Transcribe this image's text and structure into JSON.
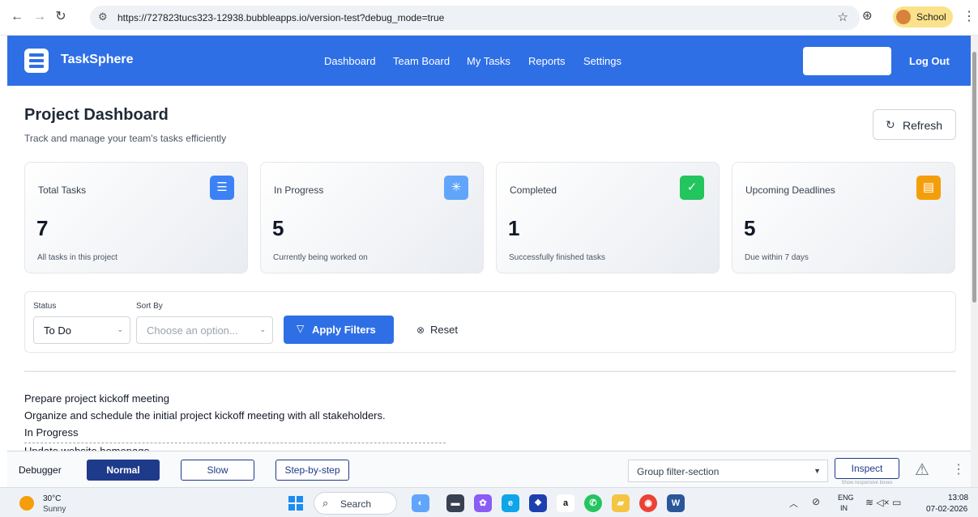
{
  "browser": {
    "url": "https://727823tucs323-12938.bubbleapps.io/version-test?debug_mode=true",
    "profile_label": "School"
  },
  "header": {
    "brand": "TaskSphere",
    "nav": [
      "Dashboard",
      "Team Board",
      "My Tasks",
      "Reports",
      "Settings"
    ],
    "logout": "Log Out"
  },
  "page": {
    "title": "Project Dashboard",
    "subtitle": "Track and manage your team's tasks efficiently",
    "refresh_label": "Refresh"
  },
  "cards": [
    {
      "title": "Total Tasks",
      "value": "7",
      "desc": "All tasks in this project",
      "icon": "checklist-icon",
      "color": "#3b82f6"
    },
    {
      "title": "In Progress",
      "value": "5",
      "desc": "Currently being worked on",
      "icon": "loader-icon",
      "color": "#60a5fa"
    },
    {
      "title": "Completed",
      "value": "1",
      "desc": "Successfully finished tasks",
      "icon": "check-circle-icon",
      "color": "#22c55e"
    },
    {
      "title": "Upcoming Deadlines",
      "value": "5",
      "desc": "Due within 7 days",
      "icon": "calendar-icon",
      "color": "#f59e0b"
    }
  ],
  "filters": {
    "status_label": "Status",
    "status_value": "To Do",
    "sort_label": "Sort By",
    "sort_placeholder": "Choose an option...",
    "apply_label": "Apply Filters",
    "reset_label": "Reset"
  },
  "tasks": {
    "lines": [
      "Prepare project kickoff meeting",
      "Organize and schedule the initial project kickoff meeting with all stakeholders.",
      "In Progress"
    ],
    "next_partial": "Update website homepage"
  },
  "debugger": {
    "label": "Debugger",
    "modes": [
      "Normal",
      "Slow",
      "Step-by-step"
    ],
    "group_value": "Group filter-section",
    "inspect_label": "Inspect",
    "inspect_note": "Show responsive boxes"
  },
  "taskbar": {
    "temp": "30°C",
    "weather": "Sunny",
    "search": "Search",
    "lang1": "ENG",
    "lang2": "IN",
    "time": "13:08",
    "date": "07-02-2026"
  }
}
